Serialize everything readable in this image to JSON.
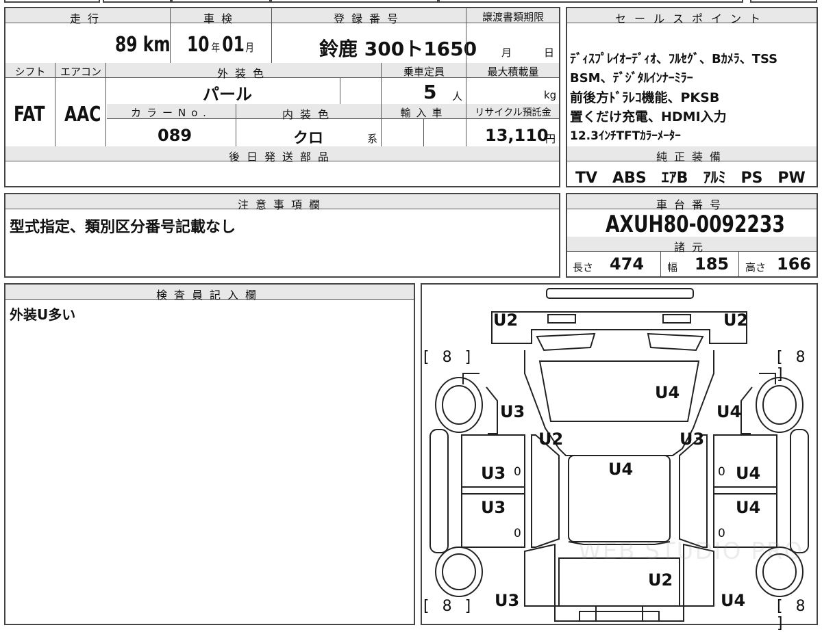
{
  "header": {
    "mileage_label": "走行",
    "inspection_label": "車検",
    "reg_label": "登録番号",
    "transfer_label": "譲渡書類期限",
    "mileage_value": "89",
    "mileage_unit": "km",
    "inspection_year": "10",
    "year_unit": "年",
    "inspection_month": "01",
    "month_unit": "月",
    "reg_number": "鈴鹿 300ト1650",
    "transfer_month": "月",
    "transfer_day": "日"
  },
  "row2": {
    "shift_label": "シフト",
    "ac_label": "エアコン",
    "exterior_label": "外装色",
    "capacity_label": "乗車定員",
    "load_label": "最大積載量",
    "shift_value": "FAT",
    "ac_value": "AAC",
    "exterior_value": "パール",
    "capacity_value": "5",
    "capacity_unit": "人",
    "load_unit": "kg",
    "color_no_label": "カラーNo.",
    "interior_label": "内装色",
    "import_label": "輸入車",
    "recycle_label": "リサイクル預託金",
    "color_no_value": "089",
    "interior_value": "クロ",
    "interior_suffix": "系",
    "recycle_value": "13,110",
    "recycle_unit": "円"
  },
  "parts": {
    "label": "後日発送部品",
    "value": ""
  },
  "sales": {
    "label": "セールスポイント",
    "lines": [
      "ﾃﾞｨｽﾌﾟﾚｲｵｰﾃﾞｨｵ、ﾌﾙｾｸﾞ、Bｶﾒﾗ、TSS",
      "BSM、ﾃﾞｼﾞﾀﾙｲﾝﾅｰﾐﾗｰ",
      "前後方ﾄﾞﾗﾚｺ機能、PKSB",
      "置くだけ充電、HDMI入力",
      "12.3ｲﾝﾁTFTｶﾗｰﾒｰﾀｰ"
    ]
  },
  "equipment": {
    "label": "純正装備",
    "value": "TV　ABS　ｴｱB　ｱﾙﾐ　PS　PW"
  },
  "notes": {
    "label": "注意事項欄",
    "value": "型式指定、類別区分番号記載なし"
  },
  "chassis": {
    "label": "車台番号",
    "value": "AXUH80-0092233"
  },
  "specs": {
    "label": "諸元",
    "length_label": "長さ",
    "length": "474",
    "width_label": "幅",
    "width": "185",
    "height_label": "高さ",
    "height": "166"
  },
  "inspector": {
    "label": "検査員記入欄",
    "value": "外装U多い"
  },
  "diagram": {
    "marks": {
      "rear_left": "U2",
      "rear_right": "U2",
      "rear_bracket_left": "[ 8 ]",
      "rear_bracket_right": "[ 8 ]",
      "roof_right": "U4",
      "side_left_upper": "U3",
      "side_right_upper": "U4",
      "pillar_left": "U2",
      "pillar_right": "U3",
      "hood_center": "U4",
      "door_left_rear": "U3",
      "door_right_rear": "U4",
      "door_left_front": "U3",
      "door_right_front": "U4",
      "zero_1": "0",
      "zero_2": "0",
      "zero_3": "0",
      "zero_4": "0",
      "front_center": "U2",
      "front_bracket_left": "[ 8 ]",
      "front_bracket_right": "[ 8 ]",
      "front_left": "U3",
      "front_right": "U4"
    },
    "watermark": "WEB STUDIO PRO"
  }
}
